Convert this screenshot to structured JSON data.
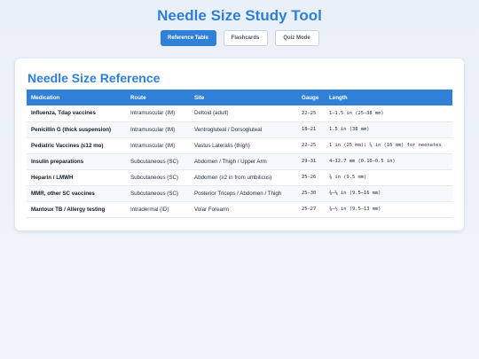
{
  "app": {
    "title": "Needle Size Study Tool"
  },
  "tabs": [
    {
      "label": "Reference Table"
    },
    {
      "label": "Flashcards"
    },
    {
      "label": "Quiz Mode"
    }
  ],
  "reference": {
    "title": "Needle Size Reference",
    "columns": [
      "Medication",
      "Route",
      "Site",
      "Gauge",
      "Length"
    ],
    "rows": [
      {
        "medication": "Influenza, Tdap vaccines",
        "route": "Intramuscular (IM)",
        "site": "Deltoid (adult)",
        "gauge": "22–25",
        "length": "1–1.5 in (25–38 mm)"
      },
      {
        "medication": "Penicillin G (thick suspension)",
        "route": "Intramuscular (IM)",
        "site": "Ventrogluteal / Dorsogluteal",
        "gauge": "18–21",
        "length": "1.5 in (38 mm)"
      },
      {
        "medication": "Pediatric Vaccines (≤12 mo)",
        "route": "Intramuscular (IM)",
        "site": "Vastus Lateralis (thigh)",
        "gauge": "22–25",
        "length": "1 in (25 mm); ⅝ in (16 mm) for neonates"
      },
      {
        "medication": "Insulin preparations",
        "route": "Subcutaneous (SC)",
        "site": "Abdomen / Thigh / Upper Arm",
        "gauge": "29–31",
        "length": "4–12.7 mm (0.16–0.5 in)"
      },
      {
        "medication": "Heparin / LMWH",
        "route": "Subcutaneous (SC)",
        "site": "Abdomen (≥2 in from umbilicus)",
        "gauge": "25–26",
        "length": "⅜ in (9.5 mm)"
      },
      {
        "medication": "MMR, other SC vaccines",
        "route": "Subcutaneous (SC)",
        "site": "Posterior Triceps / Abdomen / Thigh",
        "gauge": "25–30",
        "length": "⅜–⅝ in (9.5–16 mm)"
      },
      {
        "medication": "Mantoux TB / Allergy testing",
        "route": "Intradermal (ID)",
        "site": "Volar Forearm",
        "gauge": "25–27",
        "length": "⅜–½ in (9.5–13 mm)"
      }
    ]
  }
}
